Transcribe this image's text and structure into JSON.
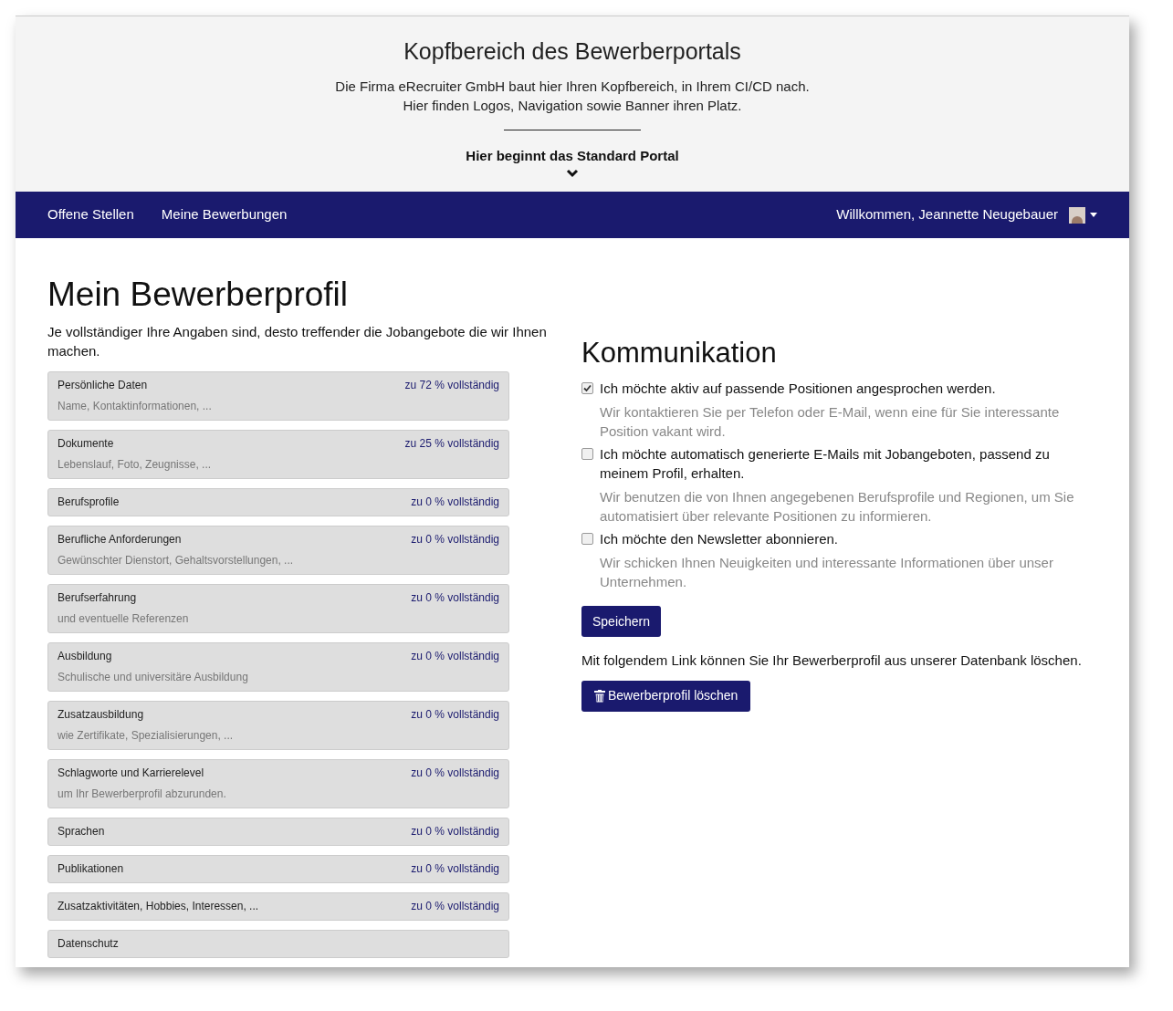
{
  "header": {
    "title": "Kopfbereich des Bewerberportals",
    "lines": [
      "Die Firma eRecruiter GmbH baut hier Ihren Kopfbereich, in Ihrem CI/CD nach.",
      "Hier finden Logos, Navigation sowie Banner ihren Platz."
    ],
    "portal_start": "Hier beginnt das Standard Portal"
  },
  "nav": {
    "links": [
      "Offene Stellen",
      "Meine Bewerbungen"
    ],
    "welcome": "Willkommen, Jeannette Neugebauer"
  },
  "profile": {
    "title": "Mein Bewerberprofil",
    "intro": "Je vollständiger Ihre Angaben sind, desto treffender die Jobangebote die wir Ihnen machen.",
    "sections": [
      {
        "title": "Persönliche Daten",
        "status": "zu 72 % vollständig",
        "subtitle": "Name, Kontaktinformationen, ..."
      },
      {
        "title": "Dokumente",
        "status": "zu 25 % vollständig",
        "subtitle": "Lebenslauf, Foto, Zeugnisse, ..."
      },
      {
        "title": "Berufsprofile",
        "status": "zu 0 % vollständig"
      },
      {
        "title": "Berufliche Anforderungen",
        "status": "zu 0 % vollständig",
        "subtitle": "Gewünschter Dienstort, Gehaltsvorstellungen, ..."
      },
      {
        "title": "Berufserfahrung",
        "status": "zu 0 % vollständig",
        "subtitle": "und eventuelle Referenzen"
      },
      {
        "title": "Ausbildung",
        "status": "zu 0 % vollständig",
        "subtitle": "Schulische und universitäre Ausbildung"
      },
      {
        "title": "Zusatzausbildung",
        "status": "zu 0 % vollständig",
        "subtitle": "wie Zertifikate, Spezialisierungen, ..."
      },
      {
        "title": "Schlagworte und Karrierelevel",
        "status": "zu 0 % vollständig",
        "subtitle": "um Ihr Bewerberprofil abzurunden."
      },
      {
        "title": "Sprachen",
        "status": "zu 0 % vollständig"
      },
      {
        "title": "Publikationen",
        "status": "zu 0 % vollständig"
      },
      {
        "title": "Zusatzaktivitäten, Hobbies, Interessen, ...",
        "status": "zu 0 % vollständig"
      },
      {
        "title": "Datenschutz"
      }
    ]
  },
  "communication": {
    "title": "Kommunikation",
    "options": [
      {
        "label": "Ich möchte aktiv auf passende Positionen angesprochen werden.",
        "checked": true,
        "hint": "Wir kontaktieren Sie per Telefon oder E-Mail, wenn eine für Sie interessante Position vakant wird."
      },
      {
        "label": "Ich möchte automatisch generierte E-Mails mit Jobangeboten, passend zu meinem Profil, erhalten.",
        "checked": false,
        "hint": "Wir benutzen die von Ihnen angegebenen Berufsprofile und Regionen, um Sie automatisiert über relevante Positionen zu informieren."
      },
      {
        "label": "Ich möchte den Newsletter abonnieren.",
        "checked": false,
        "hint": "Wir schicken Ihnen Neuigkeiten und interessante Informationen über unser Unternehmen."
      }
    ],
    "save_button": "Speichern",
    "delete_note": "Mit folgendem Link können Sie Ihr Bewerberprofil aus unserer Datenbank löschen.",
    "delete_button": "Bewerberprofil löschen"
  }
}
